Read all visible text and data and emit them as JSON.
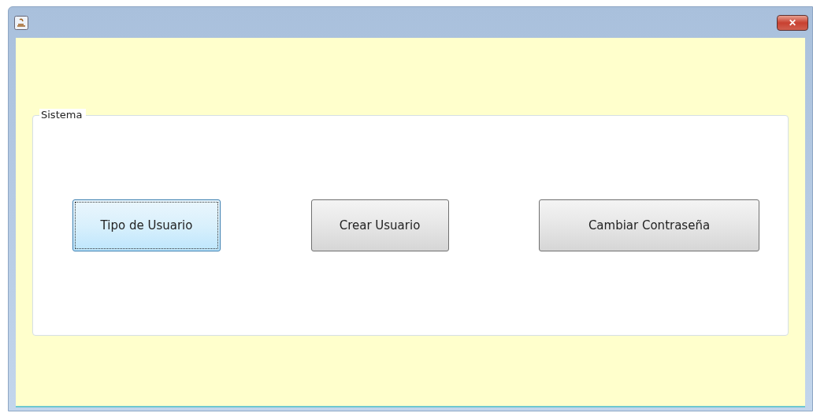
{
  "window": {
    "title_bar": {
      "close": "✕"
    }
  },
  "panel": {
    "title": "Sistema",
    "buttons": [
      {
        "label": "Tipo de Usuario",
        "selected": true
      },
      {
        "label": "Crear Usuario",
        "selected": false
      },
      {
        "label": "Cambiar Contraseña",
        "selected": false
      }
    ]
  }
}
